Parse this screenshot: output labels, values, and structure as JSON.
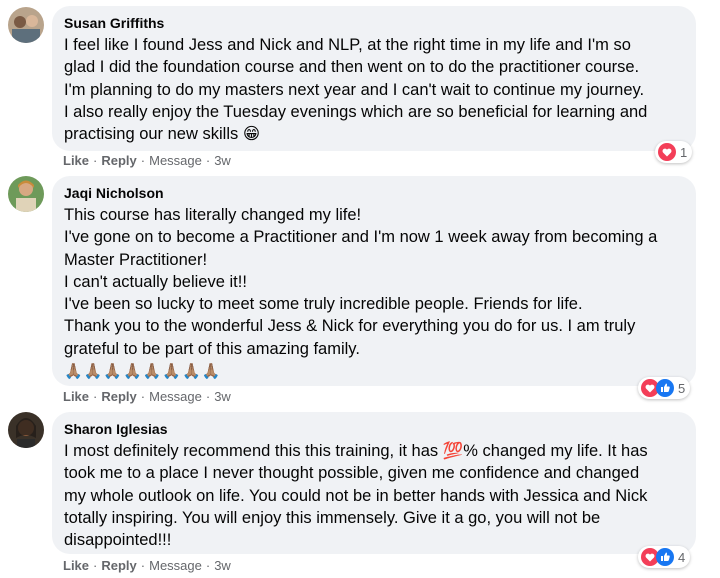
{
  "comments": [
    {
      "author": "Susan Griffiths",
      "lines": [
        "I feel like I found Jess and Nick and NLP, at the right time in my life and I'm so",
        "glad I did the foundation course and then went on to do the practitioner course.",
        "I'm planning to do my masters next year and I can't wait to continue my journey.",
        "I also really enjoy the Tuesday evenings which are so beneficial for learning and",
        "practising our new skills"
      ],
      "line_emoji": "😁",
      "actions": {
        "like": "Like",
        "reply": "Reply",
        "message": "Message",
        "time": "3w"
      },
      "reactions": {
        "count": "1",
        "types": [
          "love-icon"
        ]
      }
    },
    {
      "author": "Jaqi Nicholson",
      "lines": [
        "This course has literally changed my life!",
        "I've gone on to become a Practitioner and I'm now 1 week away from becoming a",
        "Master Practitioner!",
        "I can't actually believe it!!",
        "I've been so lucky to meet some truly incredible people. Friends for life.",
        "Thank you to the wonderful Jess & Nick for everything you do for us. I am truly",
        "grateful to be part of this amazing family."
      ],
      "emoji_row": "🙏🏽🙏🏽🙏🏽🙏🏽🙏🏽🙏🏽🙏🏽🙏🏽",
      "actions": {
        "like": "Like",
        "reply": "Reply",
        "message": "Message",
        "time": "3w"
      },
      "reactions": {
        "count": "5",
        "types": [
          "love-icon",
          "like-icon"
        ]
      }
    },
    {
      "author": "Sharon Iglesias",
      "lines_before": "I most definitely recommend this this training, it has ",
      "hundred": "💯",
      "lines_after": "% changed my life. It has",
      "lines": [
        "took me to a place I never thought possible, given me confidence and changed",
        "my whole outlook on life. You could not be in better hands with Jessica and Nick",
        "totally inspiring. You will enjoy this immensely. Give it a go, you will not be",
        "disappointed!!!"
      ],
      "actions": {
        "like": "Like",
        "reply": "Reply",
        "message": "Message",
        "time": "3w"
      },
      "reactions": {
        "count": "4",
        "types": [
          "love-icon",
          "like-icon"
        ]
      }
    }
  ],
  "colors": {
    "bubble": "#f0f2f5",
    "meta": "#65676b",
    "love": "#f33e58",
    "like": "#1877f2"
  }
}
